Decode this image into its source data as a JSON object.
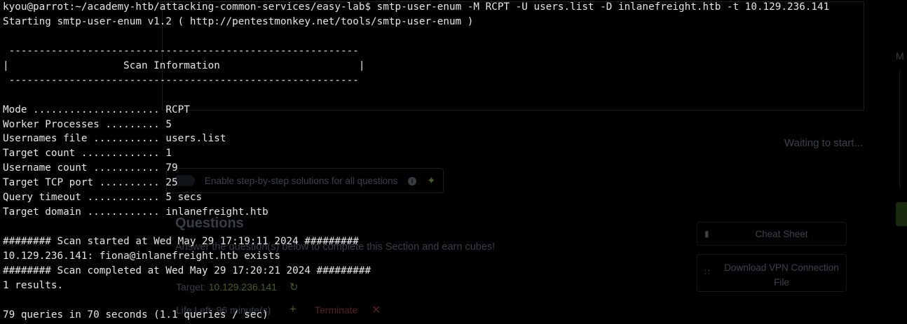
{
  "terminal": {
    "prompt": "kyou@parrot:~/academy-htb/attacking-common-services/easy-lab$",
    "command": "smtp-user-enum -M RCPT -U users.list -D inlanefreight.htb -t 10.129.236.141",
    "lines": [
      "Starting smtp-user-enum v1.2 ( http://pentestmonkey.net/tools/smtp-user-enum )",
      "",
      " ----------------------------------------------------------",
      "|                   Scan Information                       |",
      " ----------------------------------------------------------",
      "",
      "Mode ..................... RCPT",
      "Worker Processes ......... 5",
      "Usernames file ........... users.list",
      "Target count ............. 1",
      "Username count ........... 79",
      "Target TCP port .......... 25",
      "Query timeout ............ 5 secs",
      "Target domain ............ inlanefreight.htb",
      "",
      "######## Scan started at Wed May 29 17:19:11 2024 #########",
      "10.129.236.141: fiona@inlanefreight.htb exists",
      "######## Scan completed at Wed May 29 17:20:21 2024 #########",
      "1 results.",
      "",
      "79 queries in 70 seconds (1.1 queries / sec)"
    ]
  },
  "background_page": {
    "right_edge_text": "M",
    "waiting_text": "Waiting to start...",
    "solutions_toggle_label": "Enable step-by-step solutions for all questions",
    "info_icon_glyph": "i",
    "questions_title": "Questions",
    "questions_subtitle": "Answer the question(s) below to complete this Section and earn cubes!",
    "target_label": "Target:",
    "target_ip": "10.129.236.141",
    "life_left": "Life Left: 96 minute(s)",
    "terminate_label": "Terminate",
    "cheat_sheet_label": "Cheat Sheet",
    "vpn_label": "Download VPN Connection File"
  },
  "colors": {
    "terminal_background": "#000000",
    "terminal_text": "#e6e6e6",
    "faded_accent_green": "#4b5c22",
    "faded_terminate_red": "#5a1f24"
  },
  "icons": {
    "info": "info-icon",
    "magic": "magic-wand-icon",
    "refresh": "refresh-icon",
    "plus": "plus-icon",
    "close": "close-icon",
    "document": "document-icon",
    "network": "network-icon"
  }
}
